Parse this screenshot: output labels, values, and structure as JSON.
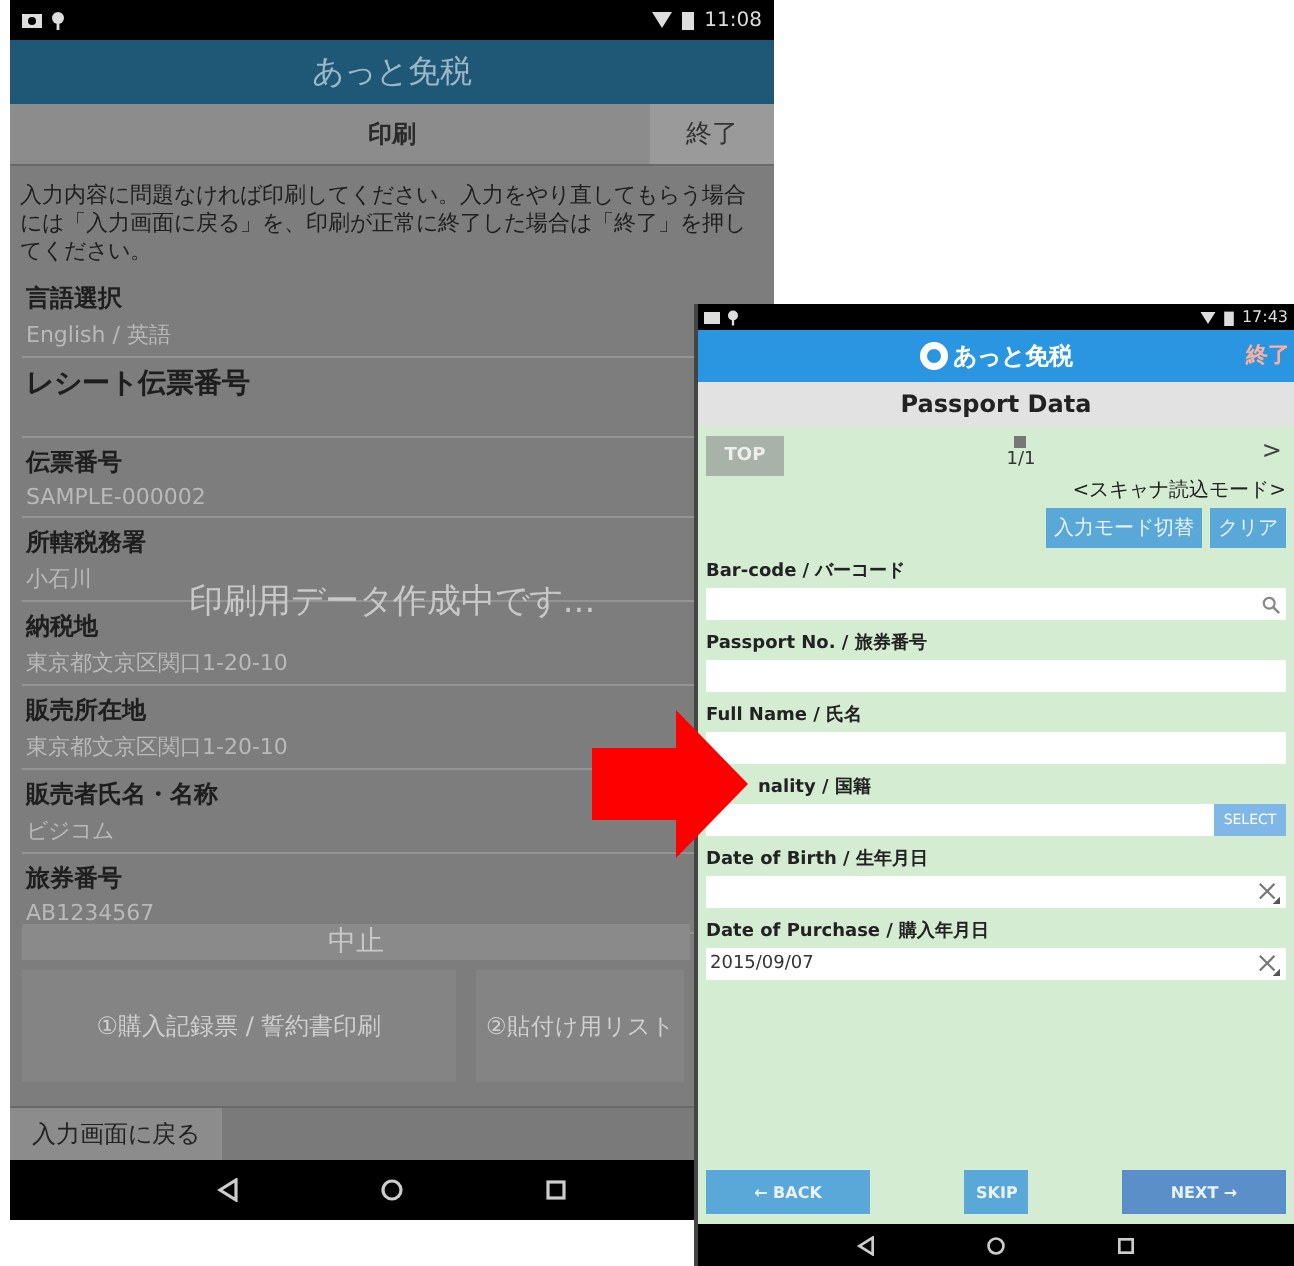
{
  "left_screen": {
    "status_bar": {
      "time": "11:08"
    },
    "app_bar": {
      "title": "あっと免税"
    },
    "header": {
      "title": "印刷",
      "end_button": "終了"
    },
    "message": "入力内容に問題なければ印刷してください。入力をやり直してもらう場合には「入力画面に戻る」を、印刷が正常に終了した場合は「終了」を押してください。",
    "fields": [
      {
        "kind": "info",
        "label": "言語選択",
        "value": "English / 英語"
      },
      {
        "kind": "large",
        "label": "レシート伝票番号"
      },
      {
        "kind": "info",
        "label": "伝票番号",
        "value": "SAMPLE-000002"
      },
      {
        "kind": "info",
        "label": "所轄税務署",
        "value": "小石川"
      },
      {
        "kind": "info",
        "label": "納税地",
        "value": "東京都文京区関口1-20-10"
      },
      {
        "kind": "info",
        "label": "販売所在地",
        "value": "東京都文京区関口1-20-10"
      },
      {
        "kind": "info",
        "label": "販売者氏名・名称",
        "value": "ビジコム"
      },
      {
        "kind": "info",
        "label": "旅券番号",
        "value": "AB1234567"
      }
    ],
    "overlay": {
      "message": "印刷用データ作成中です...",
      "cancel_button": "中止"
    },
    "print_buttons": [
      "①購入記録票 / 誓約書印刷",
      "②貼付け用リスト"
    ],
    "back_button": "入力画面に戻る"
  },
  "right_screen": {
    "status_bar": {
      "time": "17:43"
    },
    "app_bar": {
      "title": "あっと免税",
      "end_button": "終了"
    },
    "header": {
      "title": "Passport Data"
    },
    "top_button": "TOP",
    "page_indicator": "1/1",
    "next_page": ">",
    "mode_label": "<スキャナ読込モード>",
    "mode_buttons": [
      "入力モード切替",
      "クリア"
    ],
    "fields": [
      {
        "kind": "search",
        "label": "Bar-code / バーコード"
      },
      {
        "kind": "text",
        "label": "Passport No. / 旅券番号"
      },
      {
        "kind": "text",
        "label": "Full Name / 氏名"
      },
      {
        "kind": "select",
        "label": "nality / 国籍",
        "button": "SELECT"
      },
      {
        "kind": "date",
        "label": "Date of Birth / 生年月日"
      },
      {
        "kind": "date",
        "label": "Date of Purchase / 購入年月日",
        "value": "2015/09/07"
      }
    ],
    "footer_buttons": [
      {
        "kind": "back",
        "label": "← BACK"
      },
      {
        "kind": "skip",
        "label": "SKIP"
      },
      {
        "kind": "next",
        "label": "NEXT →"
      }
    ]
  }
}
